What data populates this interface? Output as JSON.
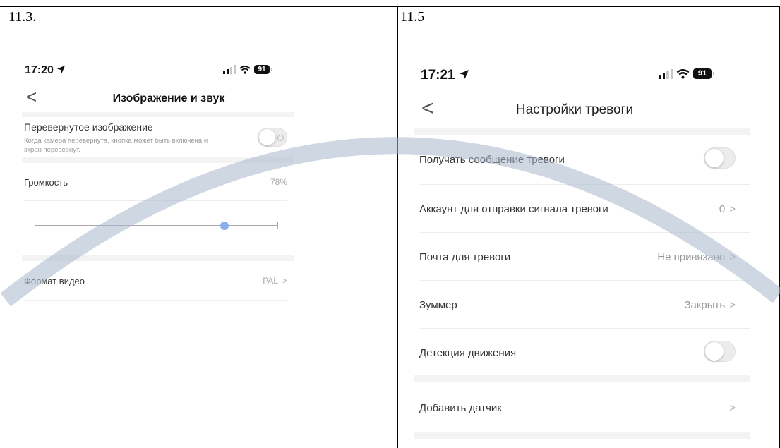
{
  "panels": [
    {
      "caption": "11.3.",
      "status": {
        "time": "17:20",
        "battery": "91"
      },
      "nav": {
        "back_symbol": "<",
        "title": "Изображение и звук"
      },
      "flip": {
        "label": "Перевернутое изображение",
        "description_line1": "Когда камера перевернута, кнопка может быть включена и",
        "description_line2": "экран перевернут.",
        "toggle_on": false
      },
      "volume": {
        "label": "Громкость",
        "value_text": "78%",
        "level": 0.78
      },
      "video_format": {
        "label": "Формат видео",
        "value": "PAL",
        "chevron": ">"
      }
    },
    {
      "caption": "11.5",
      "status": {
        "time": "17:21",
        "battery": "91"
      },
      "nav": {
        "back_symbol": "<",
        "title": "Настройки тревоги"
      },
      "rows": [
        {
          "label": "Получать сообщение тревоги",
          "toggle_on": false
        },
        {
          "label": "Аккаунт для отправки сигнала тревоги",
          "value": "0",
          "chevron": ">"
        },
        {
          "label": "Почта для тревоги",
          "value": "Не привязано",
          "chevron": ">"
        },
        {
          "label": "Зуммер",
          "value": "Закрыть",
          "chevron": ">"
        },
        {
          "label": "Детекция движения",
          "toggle_on": false
        },
        {
          "label": "Добавить датчик",
          "chevron": ">"
        }
      ]
    }
  ],
  "colors": {
    "watermark": "#a7b6ca",
    "slider_thumb": "#8aaef0"
  },
  "icons": [
    "location-arrow-icon",
    "signal-bars-icon",
    "wifi-icon",
    "battery-icon",
    "back-chevron-icon",
    "chevron-right-icon"
  ]
}
